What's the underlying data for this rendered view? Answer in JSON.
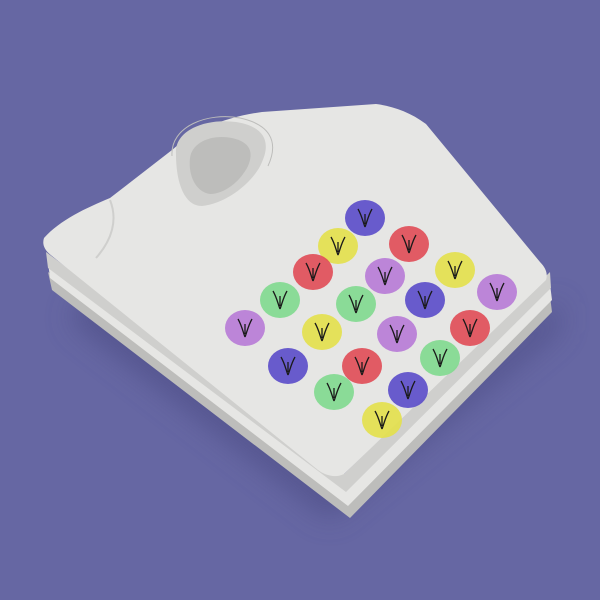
{
  "scene": {
    "background_color": "#6667a3",
    "shadow_color": "#4f5088",
    "shirt_color": "#e6e6e4",
    "shirt_shade_color": "#cfcfcd",
    "shirt_edge_color": "#bdbdbb",
    "ink_color": "#1a1a1a"
  },
  "print": {
    "palette": [
      "#5a4bc9",
      "#e3e04a",
      "#e04b55",
      "#b77ad6",
      "#7fd98e"
    ],
    "dot_colors": [
      "#5a4bc9",
      "#e3e04a",
      "#e04b55",
      "#e04b55",
      "#b77ad6",
      "#e3e04a",
      "#7fd98e",
      "#7fd98e",
      "#5a4bc9",
      "#b77ad6",
      "#b77ad6",
      "#e3e04a",
      "#b77ad6",
      "#e04b55",
      "#5a4bc9",
      "#e04b55",
      "#7fd98e",
      "#7fd98e",
      "#5a4bc9",
      "#e3e04a"
    ]
  }
}
